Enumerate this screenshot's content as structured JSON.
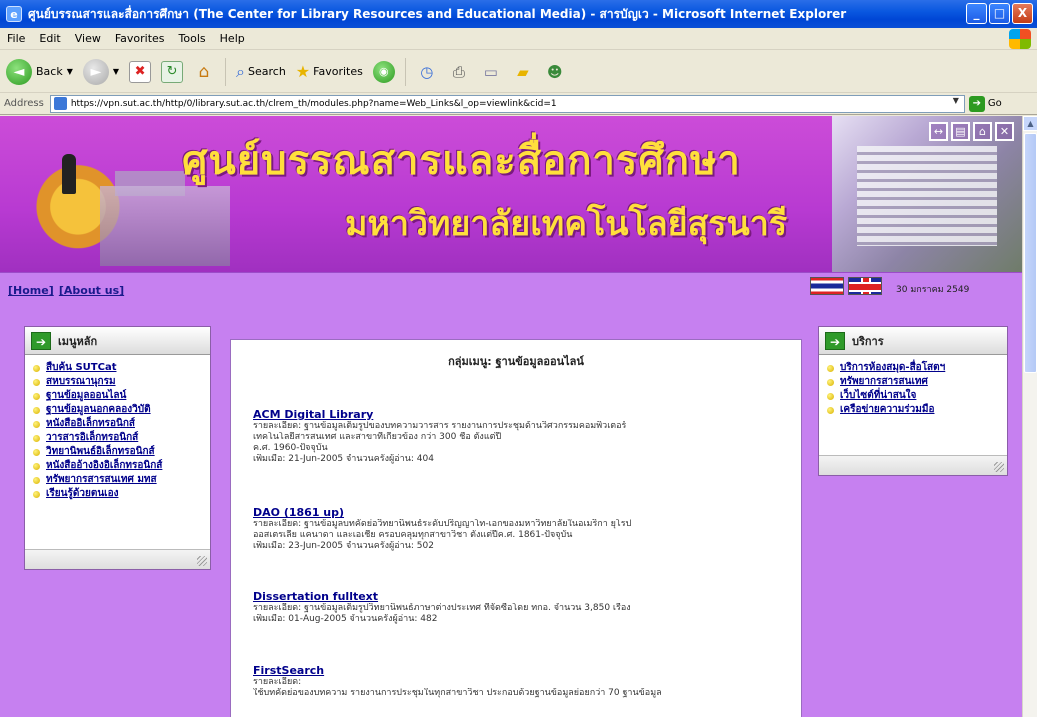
{
  "window": {
    "title": "ศูนย์บรรณสารและสื่อการศึกษา (The Center for Library Resources and Educational Media) - สารบัญเว - Microsoft Internet Explorer",
    "buttons": {
      "minimize": "_",
      "maximize": "□",
      "close": "X"
    }
  },
  "menu": [
    "File",
    "Edit",
    "View",
    "Favorites",
    "Tools",
    "Help"
  ],
  "toolbar": {
    "back": "Back",
    "search": "Search",
    "favorites": "Favorites"
  },
  "address": {
    "label": "Address",
    "url": "https://vpn.sut.ac.th/http/0/library.sut.ac.th/clrem_th/modules.php?name=Web_Links&l_op=viewlink&cid=1",
    "go": "Go"
  },
  "banner": {
    "title_line1": "ศูนย์บรรณสารและสื่อการศึกษา",
    "title_line2": "มหาวิทยาลัยเทคโนโลยีสุรนารี"
  },
  "nav": {
    "home": "[Home]",
    "about": "[About us]",
    "date": "30 มกราคม 2549"
  },
  "left_box": {
    "title": "เมนูหลัก",
    "items": [
      "สืบค้น SUTCat",
      "สหบรรณานุกรม",
      "ฐานข้อมูลออนไลน์",
      "ฐานข้อมูลนอกคลองวิบัติ",
      "หนังสืออิเล็กทรอนิกส์",
      "วารสารอิเล็กทรอนิกส์",
      "วิทยานิพนธ์อิเล็กทรอนิกส์",
      "หนังสืออ้างอิงอิเล็กทรอนิกส์",
      "ทรัพยากรสารสนเทศ มทส",
      "เรียนรู้ด้วยตนเอง"
    ]
  },
  "right_box": {
    "title": "บริการ",
    "items": [
      "บริการห้องสมุด-สื่อโสตฯ",
      "ทรัพยากรสารสนเทศ",
      "เว็บไซต์ที่น่าสนใจ",
      "เครือข่ายความร่วมมือ"
    ]
  },
  "main": {
    "title": "กลุ่มเมนู: ฐานข้อมูลออนไลน์",
    "entries": [
      {
        "title": "ACM Digital Library",
        "lines": [
          "รายละเอียด: ฐานข้อมูลเต็มรูปของบทความวารสาร รายงานการประชุมด้านวิศวกรรมคอมพิวเตอร์",
          "เทคโนโลยีสารสนเทศ และสาขาที่เกี่ยวข้อง กว่า 300 ชื่อ ตั้งแต่ปี",
          "ค.ศ. 1960-ปัจจุบัน",
          "เพิ่มเมื่อ: 21-Jun-2005 จำนวนครั้งผู้อ่าน: 404"
        ]
      },
      {
        "title": "DAO (1861 up)",
        "lines": [
          "รายละเอียด: ฐานข้อมูลบทคัดย่อวิทยานิพนธ์ระดับปริญญาโท-เอกของมหาวิทยาลัยในอเมริกา ยุโรป",
          "ออสเตรเลีย แคนาดา และเอเชีย ครอบคลุมทุกสาขาวิชา ตั้งแต่ปีค.ศ. 1861-ปัจจุบัน",
          "เพิ่มเมื่อ: 23-Jun-2005 จำนวนครั้งผู้อ่าน: 502"
        ]
      },
      {
        "title": "Dissertation fulltext",
        "lines": [
          "รายละเอียด: ฐานข้อมูลเต็มรูปวิทยานิพนธ์ภาษาต่างประเทศ ที่จัดซื้อโดย ทกอ. จำนวน 3,850 เรื่อง",
          "เพิ่มเมื่อ: 01-Aug-2005 จำนวนครั้งผู้อ่าน: 482"
        ]
      },
      {
        "title": "FirstSearch",
        "lines": [
          "รายละเอียด:",
          "ใช้บทคัดย่อของบทความ รายงานการประชุมในทุกสาขาวิชา ประกอบด้วยฐานข้อมูลย่อยกว่า 70 ฐานข้อมูล"
        ]
      }
    ]
  }
}
